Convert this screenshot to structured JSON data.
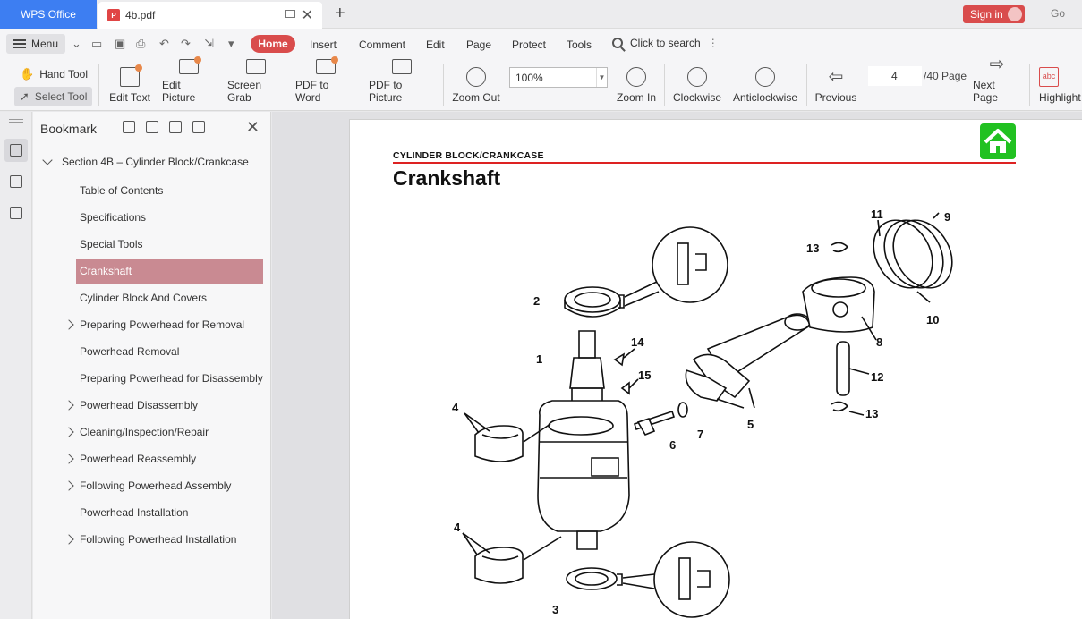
{
  "titlebar": {
    "app_name": "WPS Office",
    "doc_tab": "4b.pdf",
    "sign_in": "Sign in",
    "go_label": "Go"
  },
  "menubar": {
    "menu_label": "Menu",
    "tabs": [
      "Home",
      "Insert",
      "Comment",
      "Edit",
      "Page",
      "Protect",
      "Tools"
    ],
    "search_label": "Click to search"
  },
  "toolbar": {
    "hand_tool": "Hand Tool",
    "select_tool": "Select Tool",
    "edit_text": "Edit Text",
    "edit_picture": "Edit Picture",
    "screen_grab": "Screen Grab",
    "pdf_to_word": "PDF to Word",
    "pdf_to_picture": "PDF to Picture",
    "zoom_out": "Zoom Out",
    "zoom_value": "100%",
    "zoom_in": "Zoom In",
    "clockwise": "Clockwise",
    "anticlockwise": "Anticlockwise",
    "previous": "Previous",
    "page_current": "4",
    "page_total": "/40 Page",
    "next_page": "Next Page",
    "highlight": "Highlight",
    "highlight_icon_text": "abc"
  },
  "bookmark": {
    "title": "Bookmark",
    "root": "Section 4B – Cylinder Block/Crankcase",
    "items": [
      {
        "label": "Table of Contents",
        "expandable": false
      },
      {
        "label": "Specifications",
        "expandable": false
      },
      {
        "label": "Special Tools",
        "expandable": false
      },
      {
        "label": "Crankshaft",
        "expandable": false,
        "active": true
      },
      {
        "label": "Cylinder Block And Covers",
        "expandable": false
      },
      {
        "label": "Preparing Powerhead for Removal",
        "expandable": true
      },
      {
        "label": "Powerhead Removal",
        "expandable": false
      },
      {
        "label": "Preparing Powerhead for Disassembly",
        "expandable": false
      },
      {
        "label": "Powerhead Disassembly",
        "expandable": true
      },
      {
        "label": "Cleaning/Inspection/Repair",
        "expandable": true
      },
      {
        "label": "Powerhead Reassembly",
        "expandable": true
      },
      {
        "label": "Following Powerhead Assembly",
        "expandable": true
      },
      {
        "label": "Powerhead Installation",
        "expandable": false
      },
      {
        "label": "Following Powerhead Installation",
        "expandable": true
      }
    ]
  },
  "document": {
    "section_header": "CYLINDER BLOCK/CRANKCASE",
    "page_title": "Crankshaft",
    "callouts": [
      "1",
      "2",
      "3",
      "4",
      "4",
      "5",
      "6",
      "7",
      "8",
      "9",
      "10",
      "11",
      "12",
      "13",
      "13",
      "14",
      "15"
    ]
  },
  "colors": {
    "accent": "#d94c4c",
    "app_blue": "#3d7ef2",
    "bookmark_active": "#c98a92",
    "home_badge": "#21c121",
    "section_rule": "#dd2222"
  }
}
